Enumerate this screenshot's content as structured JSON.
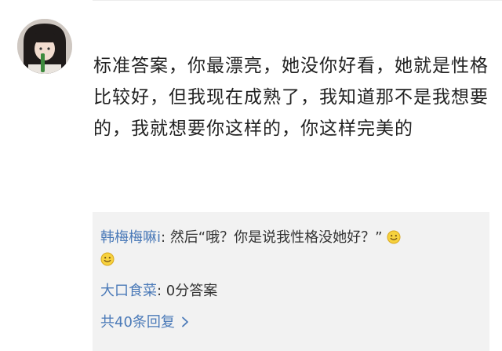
{
  "comment": {
    "avatar_icon": "user-avatar",
    "text": "标准答案，你最漂亮，她没你好看，她就是性格比较好，但我现在成熟了，我知道那不是我想要的，我就想要你这样的，你这样完美的"
  },
  "replies": [
    {
      "user": "韩梅梅嘛i",
      "separator": ": ",
      "text": "然后“哦？你是说我性格没她好？”",
      "emoji_count": 2,
      "emoji_icon": "smile-emoji-icon"
    },
    {
      "user": "大口食菜",
      "separator": ": ",
      "text": "0分答案"
    }
  ],
  "more_replies": {
    "label": "共40条回复",
    "icon": "chevron-right-icon"
  },
  "colors": {
    "link": "#4b7ab8",
    "reply_bg": "#f2f2f2",
    "text": "#222222"
  }
}
